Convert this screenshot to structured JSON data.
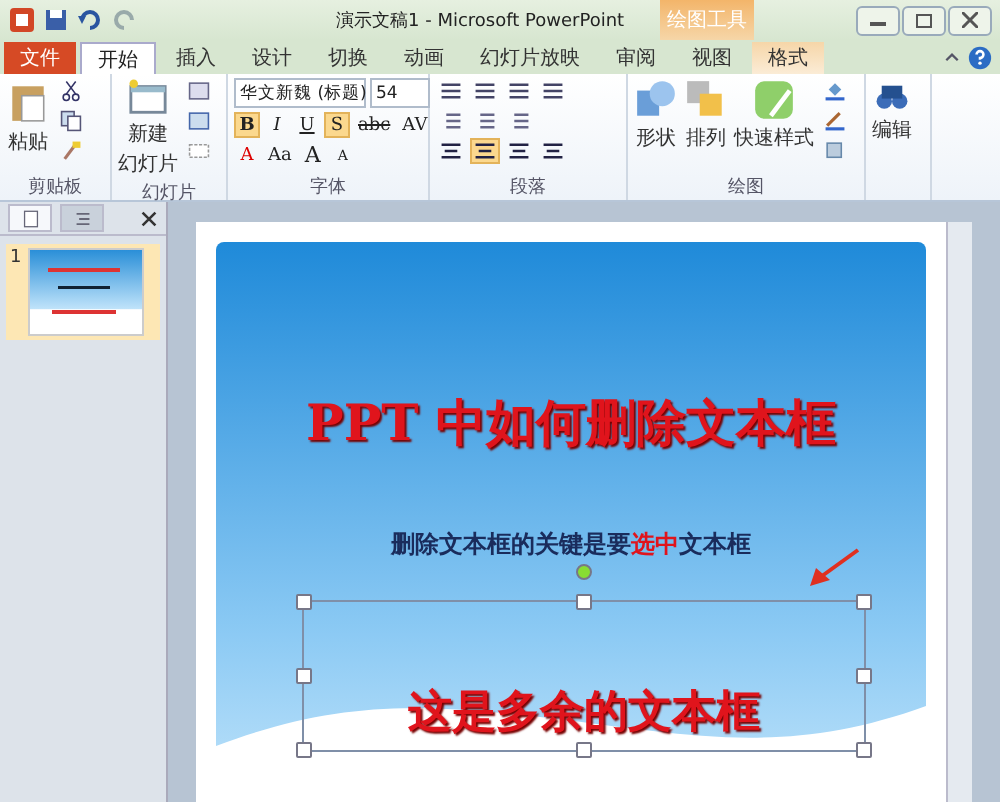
{
  "title_bar": {
    "title": "演示文稿1 - Microsoft PowerPoint",
    "contextual_label": "绘图工具"
  },
  "tabs": [
    {
      "label": "文件",
      "kind": "file",
      "selected": false
    },
    {
      "label": "开始",
      "kind": "normal",
      "selected": true
    },
    {
      "label": "插入",
      "kind": "normal",
      "selected": false
    },
    {
      "label": "设计",
      "kind": "normal",
      "selected": false
    },
    {
      "label": "切换",
      "kind": "normal",
      "selected": false
    },
    {
      "label": "动画",
      "kind": "normal",
      "selected": false
    },
    {
      "label": "幻灯片放映",
      "kind": "normal",
      "selected": false
    },
    {
      "label": "审阅",
      "kind": "normal",
      "selected": false
    },
    {
      "label": "视图",
      "kind": "normal",
      "selected": false
    },
    {
      "label": "格式",
      "kind": "contextual",
      "selected": false
    }
  ],
  "ribbon": {
    "clipboard": {
      "label": "剪贴板",
      "paste": "粘贴"
    },
    "slides": {
      "label": "幻灯片",
      "new_slide": "新建",
      "new_slide_sub": "幻灯片"
    },
    "font": {
      "label": "字体",
      "font_name": "华文新魏 (标题)",
      "font_size": "54",
      "row1": [
        {
          "label": "B",
          "selected": true
        },
        {
          "label": "I",
          "selected": false
        },
        {
          "label": "U",
          "selected": false
        },
        {
          "label": "S",
          "selected": true
        },
        {
          "label": "abc",
          "selected": false
        },
        {
          "label": "AV",
          "selected": false
        }
      ],
      "row2": [
        {
          "label": "A",
          "selected": false
        },
        {
          "label": "Aa",
          "selected": false
        },
        {
          "label": "A",
          "selected": false
        },
        {
          "label": "A",
          "selected": false
        }
      ]
    },
    "paragraph": {
      "label": "段落",
      "align": [
        {
          "selected": false
        },
        {
          "selected": true
        },
        {
          "selected": false
        },
        {
          "selected": false
        }
      ]
    },
    "drawing": {
      "label": "绘图",
      "buttons": [
        {
          "label": "形状",
          "kind": "shapes"
        },
        {
          "label": "排列",
          "kind": "arrange"
        },
        {
          "label": "快速样式",
          "kind": "styles"
        }
      ]
    },
    "editing": {
      "label": "编辑"
    }
  },
  "slides_panel": {
    "slides": [
      {
        "number": "1",
        "selected": true
      }
    ]
  },
  "slide": {
    "title": "PPT 中如何删除文本框",
    "subtitle": [
      {
        "text": "删除文本框的关键是要",
        "highlight": false
      },
      {
        "text": "选中",
        "highlight": true
      },
      {
        "text": "文本框",
        "highlight": false
      }
    ],
    "textbox": {
      "text": "这是多余的文本框",
      "selected": true
    }
  }
}
